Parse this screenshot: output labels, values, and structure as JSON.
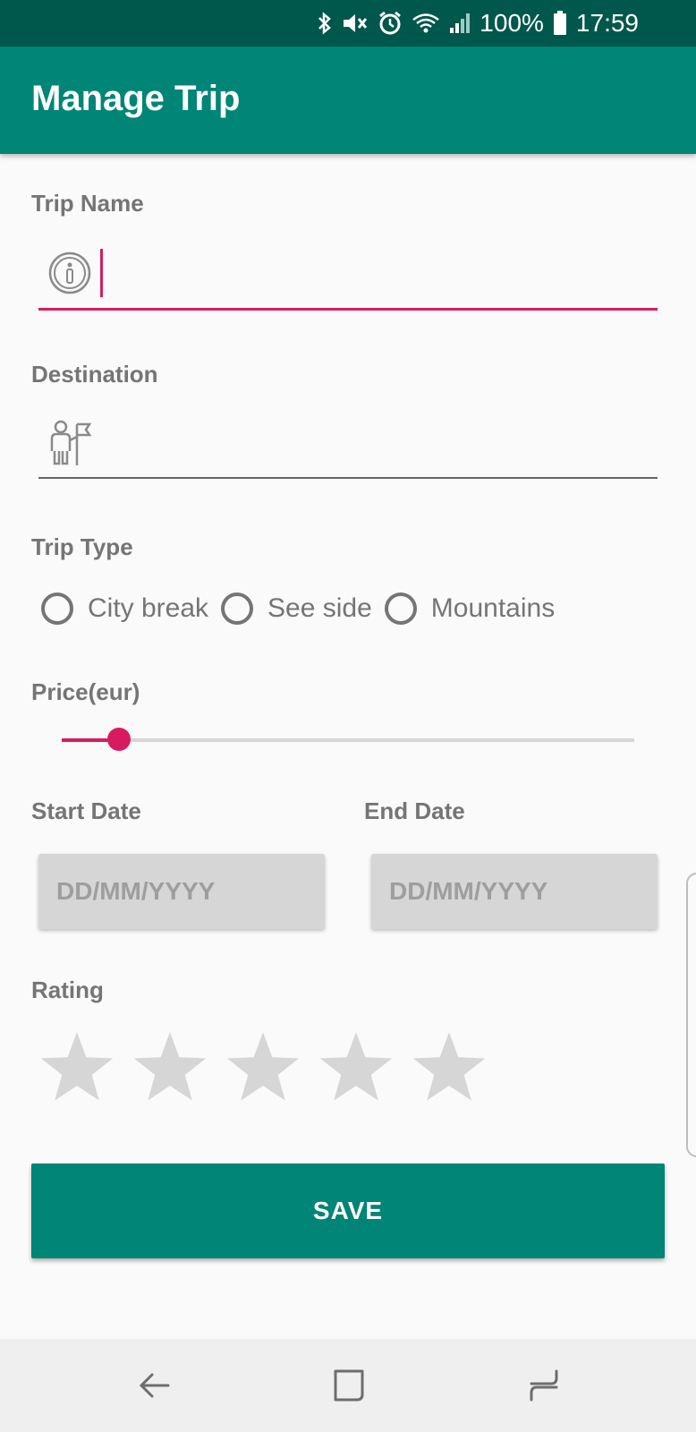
{
  "status_bar": {
    "battery": "100%",
    "time": "17:59",
    "icons": [
      "bluetooth-icon",
      "mute-icon",
      "alarm-icon",
      "wifi-icon",
      "signal-icon",
      "battery-icon"
    ]
  },
  "app_bar": {
    "title": "Manage Trip"
  },
  "form": {
    "trip_name": {
      "label": "Trip Name",
      "value": "",
      "icon": "info-icon"
    },
    "destination": {
      "label": "Destination",
      "value": "",
      "icon": "traveler-flag-icon"
    },
    "trip_type": {
      "label": "Trip Type",
      "options": [
        "City break",
        "See side",
        "Mountains"
      ],
      "selected": null
    },
    "price": {
      "label": "Price(eur)",
      "value_fraction": 0.1
    },
    "start_date": {
      "label": "Start Date",
      "placeholder": "DD/MM/YYYY"
    },
    "end_date": {
      "label": "End Date",
      "placeholder": "DD/MM/YYYY"
    },
    "rating": {
      "label": "Rating",
      "value": 0,
      "max": 5
    },
    "save_label": "SAVE"
  },
  "colors": {
    "primary": "#008577",
    "primary_dark": "#00574b",
    "accent": "#d81b60"
  },
  "nav_bar": {
    "icons": [
      "back-icon",
      "recents-icon",
      "home-icon"
    ]
  }
}
